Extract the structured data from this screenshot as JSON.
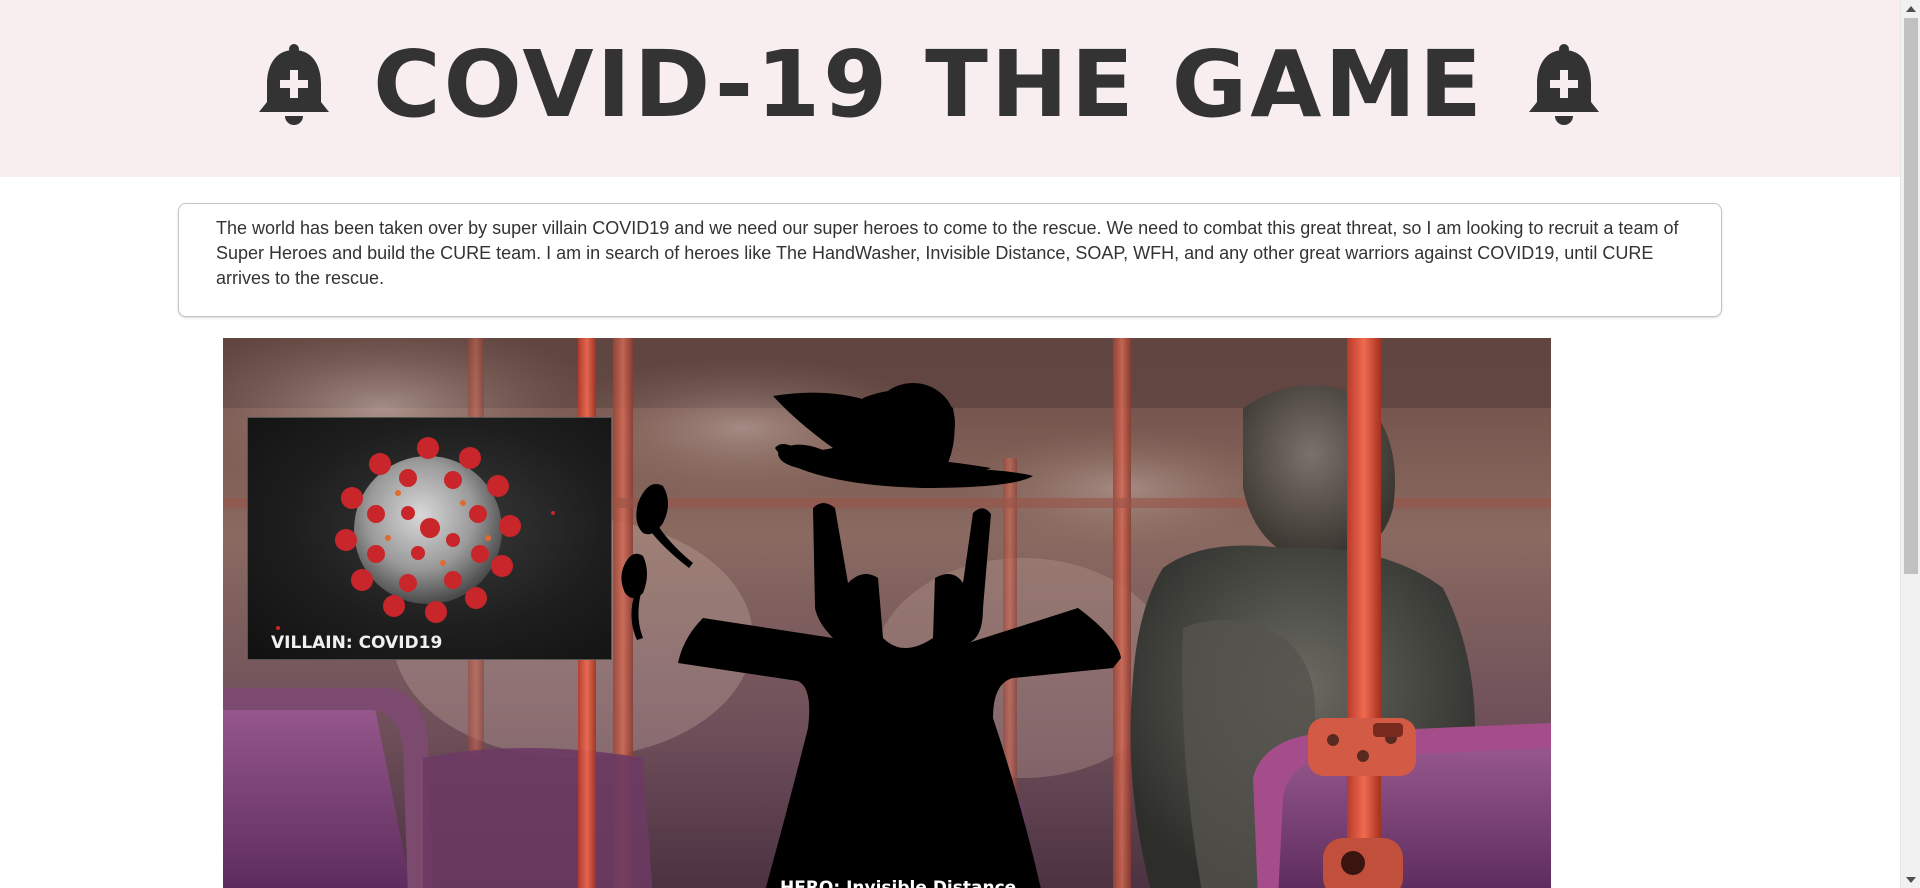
{
  "header": {
    "title": "COVID-19 THE GAME",
    "left_icon": "bell-plus-icon",
    "right_icon": "bell-plus-icon"
  },
  "intro": {
    "text": "The world has been taken over by super villain COVID19 and we need our super heroes to come to the rescue. We need to combat this great threat, so I am looking to recruit a team of Super Heroes and build the CURE team. I am in search of heroes like The HandWasher, Invisible Distance, SOAP, WFH, and any other great warriors against COVID19, until CURE arrives to the rescue."
  },
  "scene": {
    "background": "bus-interior-photo",
    "villain": {
      "label": "VILLAIN: COVID19",
      "image": "coronavirus-image"
    },
    "hero": {
      "label": "HERO: Invisible Distance",
      "image": "invisible-man-silhouette"
    }
  },
  "colors": {
    "header_bg": "#f8eeef",
    "title": "#333333",
    "virus_red": "#c8262a"
  }
}
